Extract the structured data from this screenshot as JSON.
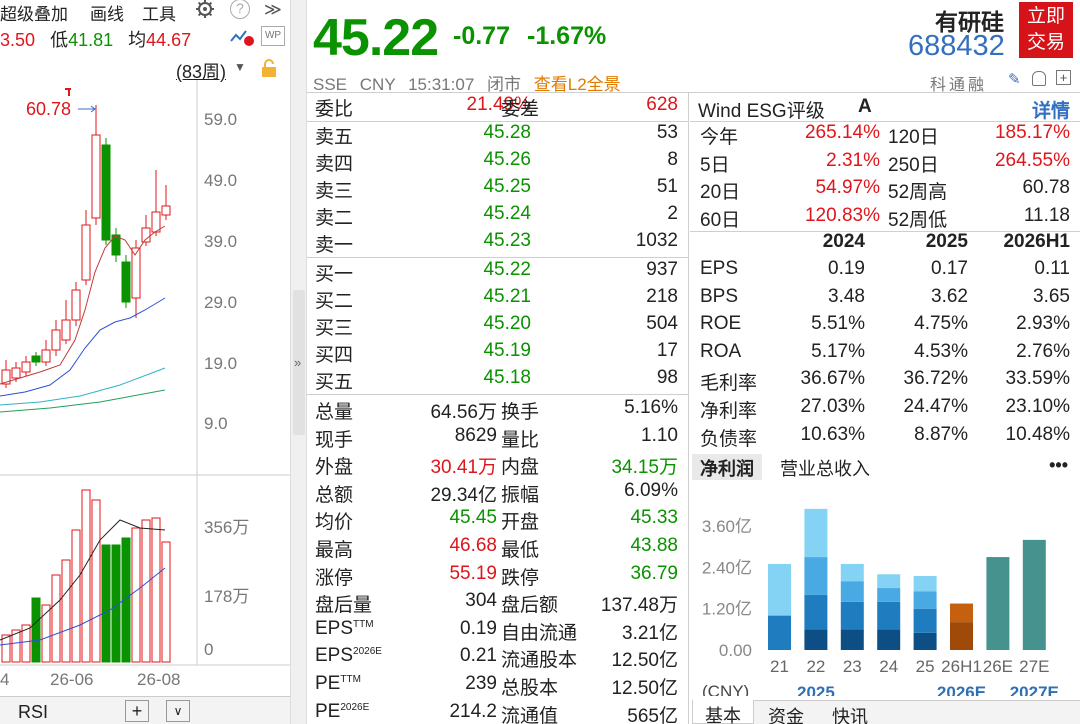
{
  "toolbar": {
    "overlay": "超级叠加",
    "draw": "画线",
    "tools": "工具",
    "help": "?",
    "expand": "≫"
  },
  "kline_info": {
    "high_partial": "3.50",
    "low_label": "低",
    "low": "41.81",
    "avg_label": "均",
    "avg": "44.67",
    "period": "(83周)"
  },
  "kline": {
    "annotation": "60.78",
    "price_ticks": [
      "59.0",
      "49.0",
      "39.0",
      "29.0",
      "19.0",
      "9.0"
    ],
    "volume_ticks": [
      "356万",
      "178万",
      "0"
    ],
    "x_ticks": [
      "4",
      "26-06",
      "26-08"
    ],
    "indicator": "RSI"
  },
  "quote": {
    "price": "45.22",
    "change": "-0.77",
    "change_pct": "-1.67%",
    "exchange": "SSE",
    "currency": "CNY",
    "time": "15:31:07",
    "status": "闭市",
    "l2_link": "查看L2全景"
  },
  "stock": {
    "name": "有研硅",
    "code": "688432",
    "trade_btn": [
      "立即",
      "交易"
    ],
    "tags": "科通融"
  },
  "orderbook": {
    "wei_bi_label": "委比",
    "wei_bi": "21.49%",
    "wei_cha_label": "委差",
    "wei_cha": "628",
    "asks": [
      {
        "label": "卖五",
        "price": "45.28",
        "vol": "53"
      },
      {
        "label": "卖四",
        "price": "45.26",
        "vol": "8"
      },
      {
        "label": "卖三",
        "price": "45.25",
        "vol": "51"
      },
      {
        "label": "卖二",
        "price": "45.24",
        "vol": "2"
      },
      {
        "label": "卖一",
        "price": "45.23",
        "vol": "1032"
      }
    ],
    "bids": [
      {
        "label": "买一",
        "price": "45.22",
        "vol": "937"
      },
      {
        "label": "买二",
        "price": "45.21",
        "vol": "218"
      },
      {
        "label": "买三",
        "price": "45.20",
        "vol": "504"
      },
      {
        "label": "买四",
        "price": "45.19",
        "vol": "17"
      },
      {
        "label": "买五",
        "price": "45.18",
        "vol": "98"
      }
    ]
  },
  "stats": [
    {
      "k1": "总量",
      "v1": "64.56万",
      "c1": "",
      "k2": "换手",
      "v2": "5.16%",
      "c2": ""
    },
    {
      "k1": "现手",
      "v1": "8629",
      "c1": "",
      "k2": "量比",
      "v2": "1.10",
      "c2": ""
    },
    {
      "k1": "外盘",
      "v1": "30.41万",
      "c1": "red",
      "k2": "内盘",
      "v2": "34.15万",
      "c2": "green"
    },
    {
      "k1": "总额",
      "v1": "29.34亿",
      "c1": "",
      "k2": "振幅",
      "v2": "6.09%",
      "c2": ""
    },
    {
      "k1": "均价",
      "v1": "45.45",
      "c1": "green",
      "k2": "开盘",
      "v2": "45.33",
      "c2": "green"
    },
    {
      "k1": "最高",
      "v1": "46.68",
      "c1": "red",
      "k2": "最低",
      "v2": "43.88",
      "c2": "green"
    },
    {
      "k1": "涨停",
      "v1": "55.19",
      "c1": "red",
      "k2": "跌停",
      "v2": "36.79",
      "c2": "green"
    },
    {
      "k1": "盘后量",
      "v1": "304",
      "c1": "",
      "k2": "盘后额",
      "v2": "137.48万",
      "c2": ""
    },
    {
      "k1": "EPS",
      "k1sup": "TTM",
      "v1": "0.19",
      "c1": "",
      "k2": "自由流通",
      "v2": "3.21亿",
      "c2": ""
    },
    {
      "k1": "EPS",
      "k1sup": "2026E",
      "v1": "0.21",
      "c1": "",
      "k2": "流通股本",
      "v2": "12.50亿",
      "c2": ""
    },
    {
      "k1": "PE",
      "k1sup": "TTM",
      "v1": "239",
      "c1": "",
      "k2": "总股本",
      "v2": "12.50亿",
      "c2": ""
    },
    {
      "k1": "PE",
      "k1sup": "2026E",
      "v1": "214.2",
      "c1": "",
      "k2": "流通值",
      "v2": "565亿",
      "c2": ""
    }
  ],
  "esg": {
    "label": "Wind ESG评级",
    "rating": "A",
    "detail": "详情"
  },
  "performance": [
    {
      "k1": "今年",
      "v1": "265.14%",
      "c1": "red",
      "k2": "120日",
      "v2": "185.17%",
      "c2": "red"
    },
    {
      "k1": "5日",
      "v1": "2.31%",
      "c1": "red",
      "k2": "250日",
      "v2": "264.55%",
      "c2": "red"
    },
    {
      "k1": "20日",
      "v1": "54.97%",
      "c1": "red",
      "k2": "52周高",
      "v2": "60.78",
      "c2": ""
    },
    {
      "k1": "60日",
      "v1": "120.83%",
      "c1": "red",
      "k2": "52周低",
      "v2": "11.18",
      "c2": ""
    }
  ],
  "financials": {
    "years": [
      "2024",
      "2025",
      "2026H1"
    ],
    "rows": [
      {
        "k": "EPS",
        "vals": [
          "0.19",
          "0.17",
          "0.11"
        ]
      },
      {
        "k": "BPS",
        "vals": [
          "3.48",
          "3.62",
          "3.65"
        ]
      },
      {
        "k": "ROE",
        "vals": [
          "5.51%",
          "4.75%",
          "2.93%"
        ]
      },
      {
        "k": "ROA",
        "vals": [
          "5.17%",
          "4.53%",
          "2.76%"
        ]
      },
      {
        "k": "毛利率",
        "vals": [
          "36.67%",
          "36.72%",
          "33.59%"
        ]
      },
      {
        "k": "净利率",
        "vals": [
          "27.03%",
          "24.47%",
          "23.10%"
        ]
      },
      {
        "k": "负债率",
        "vals": [
          "10.63%",
          "8.87%",
          "10.48%"
        ]
      }
    ]
  },
  "profit_tabs": {
    "active": "净利润",
    "other": "营业总收入",
    "more": "•••"
  },
  "chart_data": {
    "type": "bar",
    "categories": [
      "21",
      "22",
      "23",
      "24",
      "25",
      "26H1",
      "26E",
      "27E"
    ],
    "yticks": [
      "3.60亿",
      "2.40亿",
      "1.20亿",
      "0.00"
    ],
    "ylim": [
      0,
      4.3
    ],
    "unit": "(CNY)",
    "year_labels": [
      "2025",
      "2026E",
      "2027E"
    ],
    "stacked": [
      [
        0.0,
        1.0,
        0.0,
        1.5
      ],
      [
        0.6,
        1.0,
        1.1,
        1.4
      ],
      [
        0.6,
        0.8,
        0.6,
        0.5
      ],
      [
        0.6,
        0.8,
        0.4,
        0.4
      ],
      [
        0.5,
        0.7,
        0.5,
        0.45
      ]
    ],
    "single": [
      {
        "value": 1.35,
        "color": "#c5610e"
      },
      {
        "value": 2.7,
        "color": "#46928e"
      },
      {
        "value": 3.2,
        "color": "#46928e"
      }
    ],
    "stack_colors": [
      "#0d4f85",
      "#1f7cbf",
      "#49a9e2",
      "#85d3f4"
    ]
  },
  "bottom_tabs": [
    "基本",
    "资金",
    "快讯"
  ]
}
